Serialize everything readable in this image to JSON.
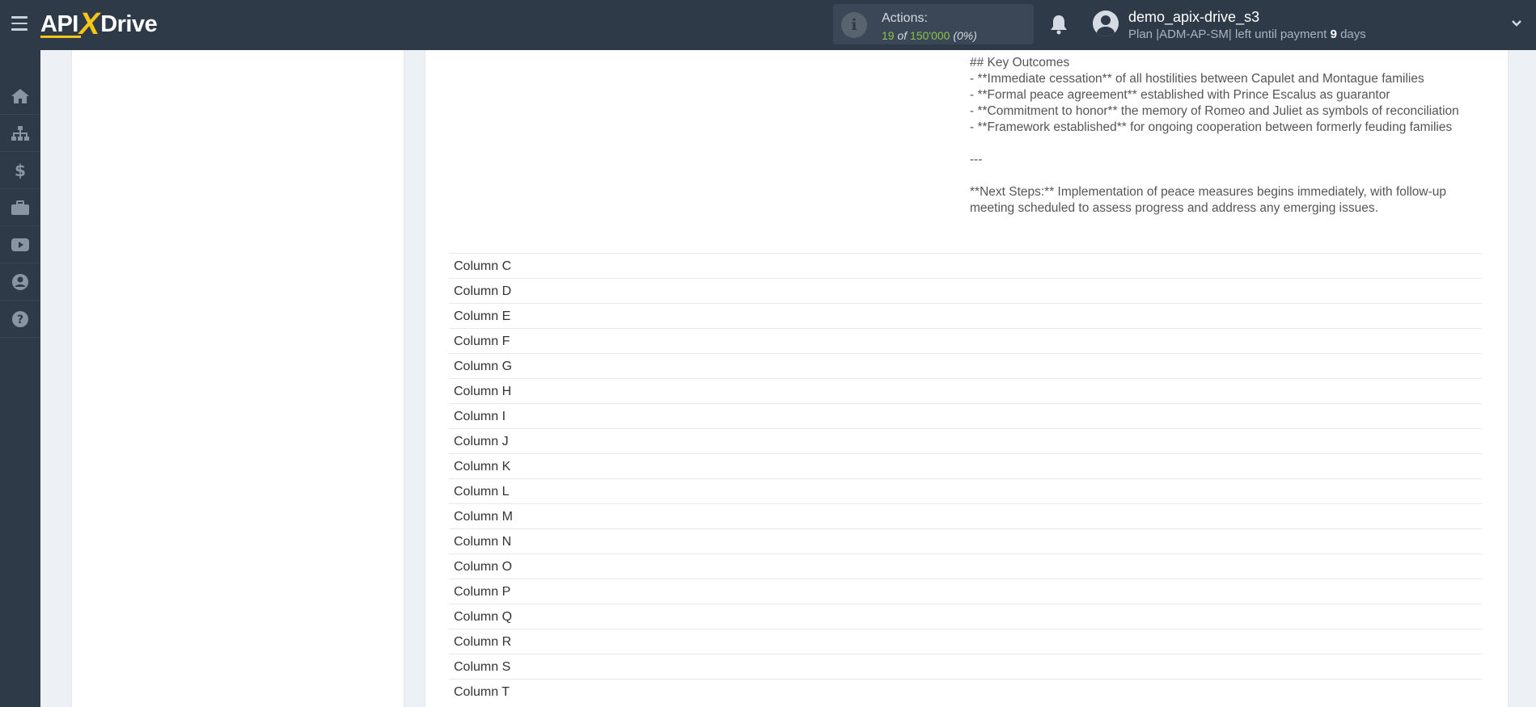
{
  "header": {
    "logo_api": "API",
    "logo_x": "X",
    "logo_drive": "Drive",
    "actions_label": "Actions:",
    "actions_used": "19",
    "actions_of": "of",
    "actions_total": "150'000",
    "actions_pct": "(0%)",
    "user_name": "demo_apix-drive_s3",
    "plan_prefix": "Plan |ADM-AP-SM| left until payment",
    "plan_days": "9",
    "plan_suffix": "days"
  },
  "sidebar": {
    "items": [
      "home-icon",
      "sitemap-icon",
      "dollar-icon",
      "briefcase-icon",
      "video-icon",
      "user-circle-icon",
      "help-icon"
    ]
  },
  "content": {
    "heading": "## Key Outcomes",
    "bullets": [
      "- **Immediate cessation** of all hostilities between Capulet and Montague families",
      "- **Formal peace agreement** established with Prince Escalus as guarantor",
      "- **Commitment to honor** the memory of Romeo and Juliet as symbols of reconciliation",
      "- **Framework established** for ongoing cooperation between formerly feuding families"
    ],
    "separator": "---",
    "next_steps": "**Next Steps:** Implementation of peace measures begins immediately, with follow-up meeting scheduled to assess progress and address any emerging issues."
  },
  "rows": [
    "Column C",
    "Column D",
    "Column E",
    "Column F",
    "Column G",
    "Column H",
    "Column I",
    "Column J",
    "Column K",
    "Column L",
    "Column M",
    "Column N",
    "Column O",
    "Column P",
    "Column Q",
    "Column R",
    "Column S",
    "Column T"
  ],
  "colors": {
    "topbar": "#2e3a48",
    "accent_yellow": "#f5c518",
    "actions_green": "#8bc34a"
  }
}
